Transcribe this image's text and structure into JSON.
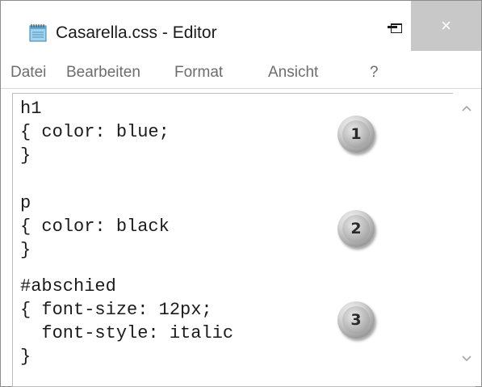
{
  "window": {
    "title": "Casarella.css - Editor",
    "controls": {
      "minimize_icon": "minimize-icon",
      "maximize_icon": "maximize-icon",
      "close_icon": "close-icon",
      "close_glyph": "×"
    }
  },
  "menu": [
    {
      "label": "Datei"
    },
    {
      "label": "Bearbeiten"
    },
    {
      "label": "Format"
    },
    {
      "label": "Ansicht"
    },
    {
      "label": "?"
    }
  ],
  "editor": {
    "lines": [
      "h1",
      "{ color: blue;",
      "}",
      "p",
      "{ color: black",
      "}",
      "#abschied",
      "{ font-size: 12px;",
      "  font-style: italic",
      "}"
    ]
  },
  "badges": [
    "1",
    "2",
    "3"
  ],
  "scrollbar": {
    "up_icon": "chevron-up-icon",
    "down_icon": "chevron-down-icon"
  }
}
